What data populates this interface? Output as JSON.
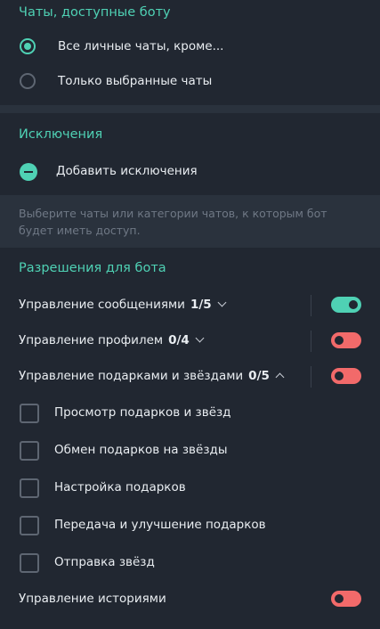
{
  "chats_section": {
    "title": "Чаты, доступные боту",
    "options": [
      {
        "label": "Все личные чаты, кроме...",
        "selected": true
      },
      {
        "label": "Только выбранные чаты",
        "selected": false
      }
    ]
  },
  "exceptions_section": {
    "title": "Исключения",
    "add_label": "Добавить исключения",
    "hint": "Выберите чаты или категории чатов, к которым бот будет иметь доступ."
  },
  "permissions_section": {
    "title": "Разрешения для бота",
    "messages": {
      "label": "Управление сообщениями",
      "count": "1/5",
      "enabled": true
    },
    "profile": {
      "label": "Управление профилем",
      "count": "0/4",
      "enabled": false
    },
    "gifts": {
      "label": "Управление подарками и звёздами",
      "count": "0/5",
      "enabled": false,
      "items": [
        {
          "label": "Просмотр подарков и звёзд",
          "checked": false
        },
        {
          "label": "Обмен подарков на звёзды",
          "checked": false
        },
        {
          "label": "Настройка подарков",
          "checked": false
        },
        {
          "label": "Передача и улучшение подарков",
          "checked": false
        },
        {
          "label": "Отправка звёзд",
          "checked": false
        }
      ]
    },
    "stories": {
      "label": "Управление историями",
      "enabled": false
    }
  },
  "colors": {
    "accent": "#4fd1b4",
    "toggle_off": "#f26a6a",
    "background": "#212731"
  }
}
